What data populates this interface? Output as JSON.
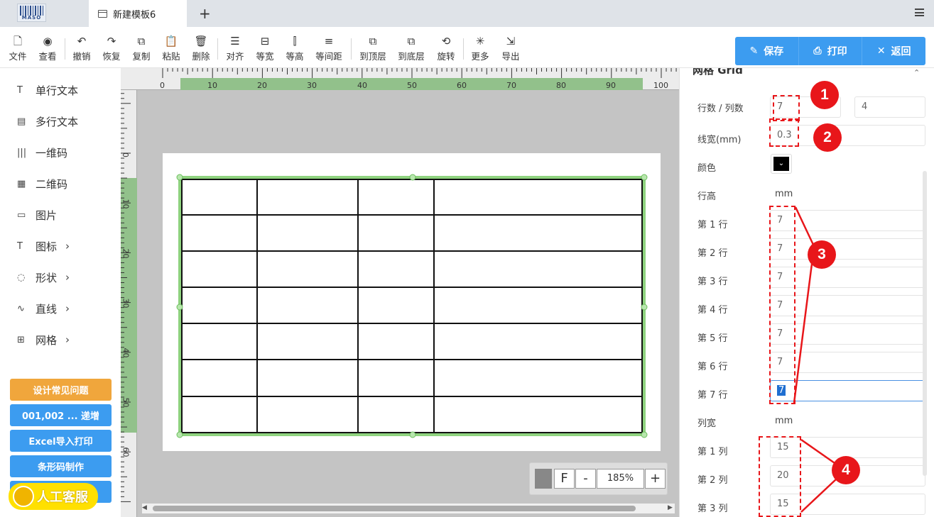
{
  "app": {
    "logo_text": "MASO",
    "tab_title": "新建模板6",
    "add_tab": "+"
  },
  "toolbar": {
    "items": [
      {
        "label": "文件",
        "icon": "file-icon"
      },
      {
        "label": "查看",
        "icon": "eye-icon"
      },
      {
        "label": "撤销",
        "icon": "undo-icon"
      },
      {
        "label": "恢复",
        "icon": "redo-icon"
      },
      {
        "label": "复制",
        "icon": "copy-icon"
      },
      {
        "label": "粘贴",
        "icon": "paste-icon"
      },
      {
        "label": "删除",
        "icon": "trash-icon"
      },
      {
        "label": "对齐",
        "icon": "align-icon"
      },
      {
        "label": "等宽",
        "icon": "equal-width-icon"
      },
      {
        "label": "等高",
        "icon": "equal-height-icon"
      },
      {
        "label": "等间距",
        "icon": "equal-spacing-icon"
      },
      {
        "label": "到顶层",
        "icon": "bring-front-icon"
      },
      {
        "label": "到底层",
        "icon": "send-back-icon"
      },
      {
        "label": "旋转",
        "icon": "rotate-icon"
      },
      {
        "label": "更多",
        "icon": "more-icon"
      },
      {
        "label": "导出",
        "icon": "export-icon"
      }
    ]
  },
  "actions": {
    "save": "保存",
    "print": "打印",
    "back": "返回"
  },
  "sidebar": {
    "items": [
      {
        "label": "单行文本",
        "icon": "T",
        "has_sub": false
      },
      {
        "label": "多行文本",
        "icon": "▤",
        "has_sub": false
      },
      {
        "label": "一维码",
        "icon": "|||",
        "has_sub": false
      },
      {
        "label": "二维码",
        "icon": "▦",
        "has_sub": false
      },
      {
        "label": "图片",
        "icon": "▭",
        "has_sub": false
      },
      {
        "label": "图标",
        "icon": "T",
        "has_sub": true
      },
      {
        "label": "形状",
        "icon": "◌",
        "has_sub": true
      },
      {
        "label": "直线",
        "icon": "∿",
        "has_sub": true
      },
      {
        "label": "网格",
        "icon": "⊞",
        "has_sub": true
      }
    ],
    "buttons": [
      "设计常见问题",
      "001,002 ... 递增",
      "Excel导入打印",
      "条形码制作"
    ],
    "help": "人工客服"
  },
  "ruler": {
    "h_labels": [
      "0",
      "10",
      "20",
      "30",
      "40",
      "50",
      "60",
      "70",
      "80",
      "90",
      "100"
    ],
    "v_labels": [
      "0",
      "10",
      "20",
      "30",
      "40",
      "50",
      "60"
    ]
  },
  "zoom": {
    "fit": "F",
    "minus": "-",
    "value": "185%",
    "plus": "+"
  },
  "props": {
    "section_title": "网格 Grid",
    "rows_cols_label": "行数 / 列数",
    "rows": "7",
    "cols": "4",
    "line_width_label": "线宽(mm)",
    "line_width": "0.3",
    "color_label": "颜色",
    "row_height_label": "行高",
    "unit": "mm",
    "rows_list": [
      {
        "label": "第 1 行",
        "value": "7"
      },
      {
        "label": "第 2 行",
        "value": "7"
      },
      {
        "label": "第 3 行",
        "value": "7"
      },
      {
        "label": "第 4 行",
        "value": "7"
      },
      {
        "label": "第 5 行",
        "value": "7"
      },
      {
        "label": "第 6 行",
        "value": "7"
      },
      {
        "label": "第 7 行",
        "value": "7"
      }
    ],
    "col_width_label": "列宽",
    "cols_list": [
      {
        "label": "第 1 列",
        "value": "15"
      },
      {
        "label": "第 2 列",
        "value": "20"
      },
      {
        "label": "第 3 列",
        "value": "15"
      }
    ]
  },
  "callouts": [
    "1",
    "2",
    "3",
    "4"
  ],
  "colors": {
    "accent": "#3c9cf0",
    "orange": "#f0a63c",
    "selection": "#8fd37f",
    "callout": "#e8161a"
  }
}
